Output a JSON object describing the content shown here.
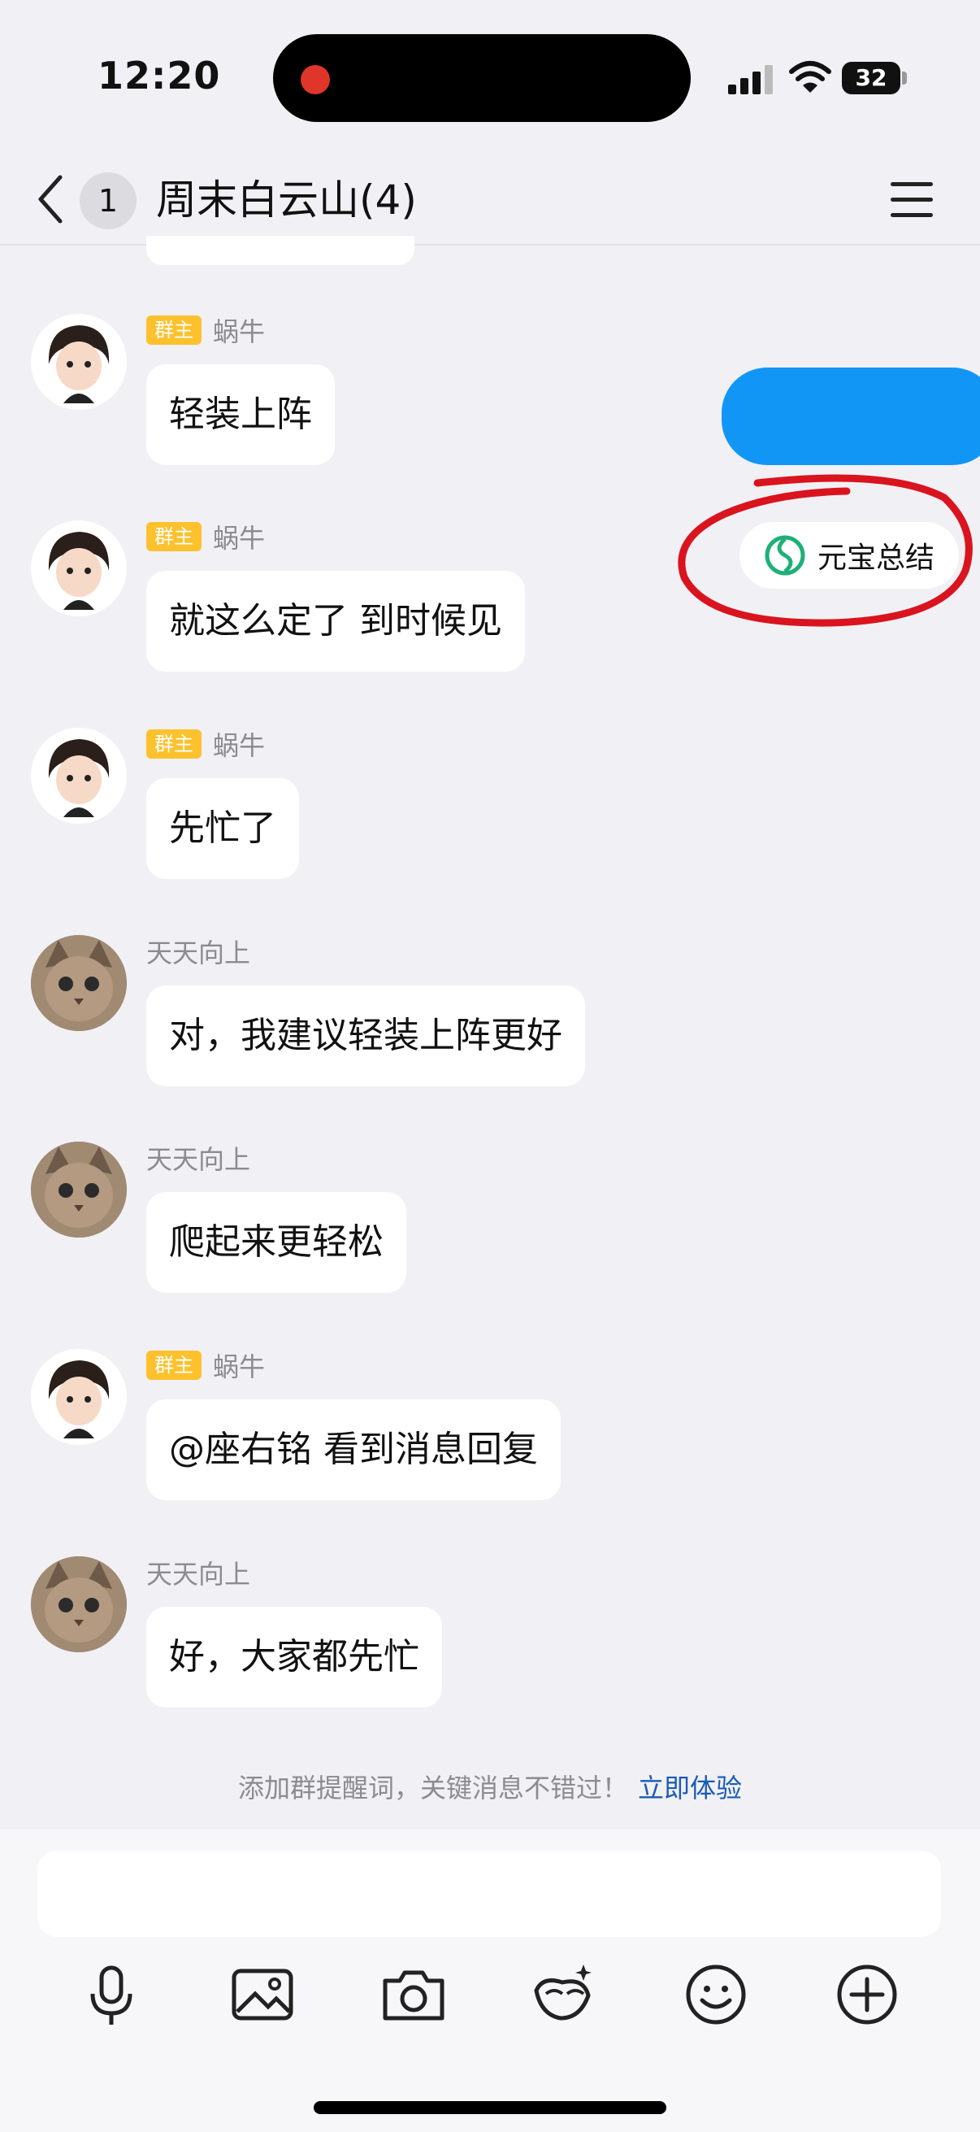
{
  "status": {
    "time": "12:20",
    "battery": "32"
  },
  "nav": {
    "unread_count": "1",
    "title": "周末白云山(4)"
  },
  "messages": [
    {
      "badge": "群主",
      "sender": "蜗牛",
      "text": "轻装上阵",
      "avatar": "avatar-snail"
    },
    {
      "badge": "群主",
      "sender": "蜗牛",
      "text": "就这么定了 到时候见",
      "avatar": "avatar-snail"
    },
    {
      "badge": "群主",
      "sender": "蜗牛",
      "text": "先忙了",
      "avatar": "avatar-snail"
    },
    {
      "badge": "",
      "sender": "天天向上",
      "text": "对，我建议轻装上阵更好",
      "avatar": "avatar-cat"
    },
    {
      "badge": "",
      "sender": "天天向上",
      "text": "爬起来更轻松",
      "avatar": "avatar-cat"
    },
    {
      "badge": "群主",
      "sender": "蜗牛",
      "text": "@座右铭 看到消息回复",
      "avatar": "avatar-snail"
    },
    {
      "badge": "",
      "sender": "天天向上",
      "text": "好，大家都先忙",
      "avatar": "avatar-cat"
    }
  ],
  "summary": {
    "label": "元宝总结",
    "icon": "yuanbao-logo-icon"
  },
  "hint": {
    "text": "添加群提醒词，关键消息不错过！",
    "link": "立即体验"
  },
  "input": {
    "placeholder": ""
  },
  "toolbar": [
    "mic-icon",
    "image-icon",
    "camera-icon",
    "ai-assistant-icon",
    "emoji-icon",
    "plus-icon"
  ],
  "colors": {
    "accent": "#1296f5",
    "badge": "#fcc12d",
    "link": "#1a5bb5",
    "annotation": "#d9141e",
    "logo": "#1fb077"
  }
}
